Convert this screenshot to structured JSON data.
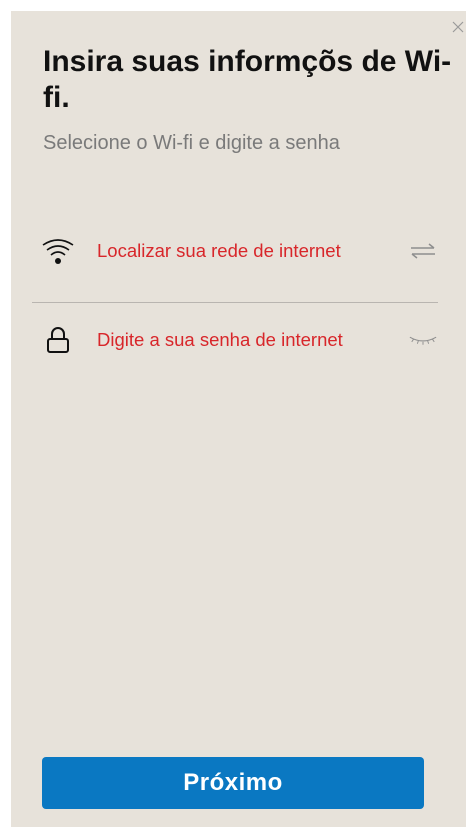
{
  "dialog": {
    "title": "Insira suas informçõs de Wi-fi.",
    "subtitle": "Selecione o Wi-fi e digite a senha",
    "close_icon": "close-icon"
  },
  "fields": {
    "network": {
      "icon": "wifi-icon",
      "label": "Localizar sua rede de internet",
      "action_icon": "swap-arrows-icon"
    },
    "password": {
      "icon": "lock-icon",
      "label": "Digite a sua senha de internet",
      "action_icon": "eye-closed-icon"
    }
  },
  "footer": {
    "next_label": "Próximo"
  },
  "colors": {
    "panel_background": "#e7e2da",
    "title": "#111111",
    "subtitle": "#7a7a7a",
    "field_text": "#d8262a",
    "button_background": "#0a78c2",
    "button_text": "#ffffff"
  }
}
